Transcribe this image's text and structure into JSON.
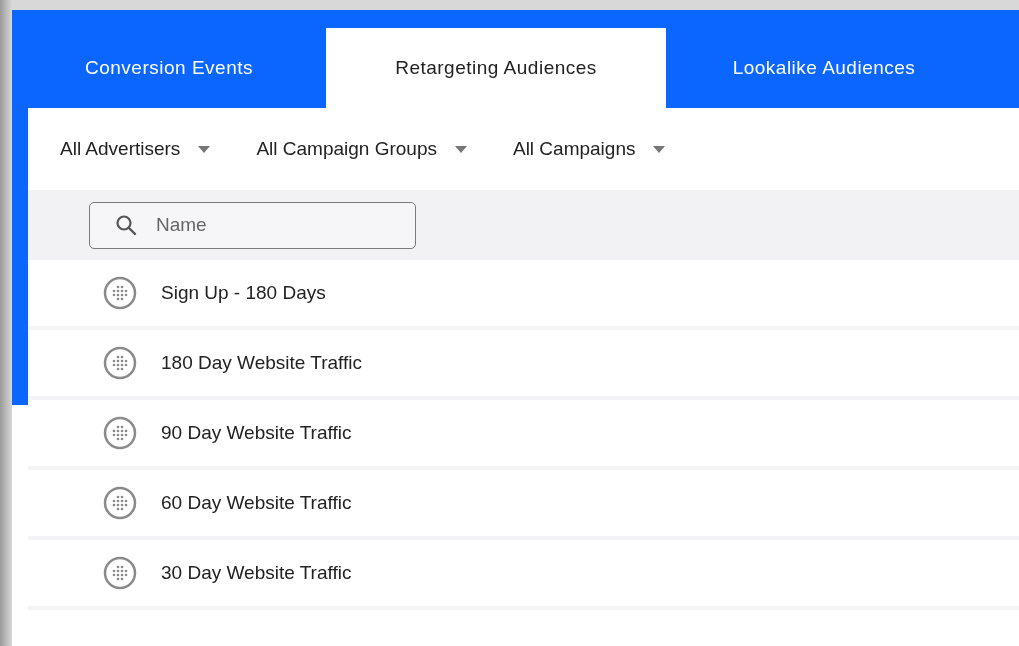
{
  "tabs": [
    {
      "label": "Conversion Events",
      "selected": false
    },
    {
      "label": "Retargeting Audiences",
      "selected": true
    },
    {
      "label": "Lookalike Audiences",
      "selected": false
    }
  ],
  "filters": [
    {
      "label": "All Advertisers"
    },
    {
      "label": "All Campaign Groups"
    },
    {
      "label": "All Campaigns"
    }
  ],
  "search": {
    "placeholder": "Name"
  },
  "audiences": [
    {
      "name": "Sign Up - 180 Days"
    },
    {
      "name": "180 Day Website Traffic"
    },
    {
      "name": "90 Day Website Traffic"
    },
    {
      "name": "60 Day Website Traffic"
    },
    {
      "name": "30 Day Website Traffic"
    }
  ]
}
